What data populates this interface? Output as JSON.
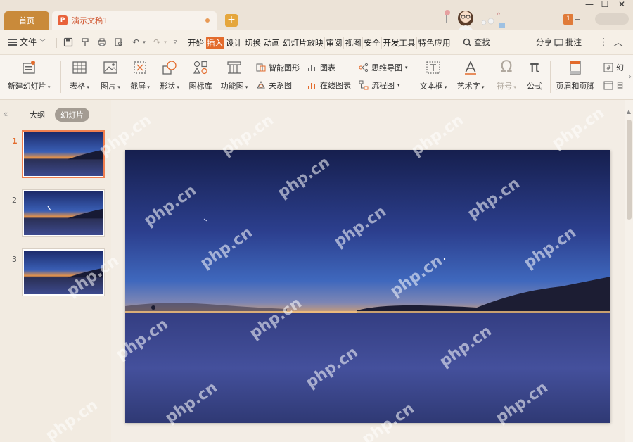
{
  "tabs": {
    "home": "首页",
    "doc_title": "演示文稿1",
    "doc_icon": "P",
    "add": "+"
  },
  "titlebar": {
    "badge": "1",
    "min": "—",
    "max": "☐",
    "close": "✕"
  },
  "menu": {
    "file": "文件",
    "tabs": [
      "开始",
      "插入",
      "设计",
      "切换",
      "动画",
      "幻灯片放映",
      "审阅",
      "视图",
      "安全",
      "开发工具",
      "特色应用"
    ],
    "active_tab": "插入",
    "search": "查找",
    "share": "分享",
    "review": "批注"
  },
  "ribbon": {
    "new_slide": "新建幻灯片",
    "table": "表格",
    "picture": "图片",
    "screenshot": "截屏",
    "shape": "形状",
    "icon_lib": "图标库",
    "func_chart": "功能图",
    "smart_graphic": "智能图形",
    "chart": "图表",
    "mind_map": "思维导图",
    "relation_chart": "关系图",
    "online_chart": "在线图表",
    "flow_chart": "流程图",
    "textbox": "文本框",
    "art_text": "艺术字",
    "symbol": "符号",
    "formula": "公式",
    "header_footer": "页眉和页脚",
    "slide_num_a": "幻",
    "slide_num_b": "日"
  },
  "left_panel": {
    "outline": "大纲",
    "slides": "幻灯片",
    "thumbnails": [
      "1",
      "2",
      "3"
    ],
    "active": "1"
  },
  "watermark": "php.cn",
  "colors": {
    "accent": "#e36b2c",
    "home_tab": "#c98a3a",
    "active_thumb_border": "#f07f50"
  }
}
